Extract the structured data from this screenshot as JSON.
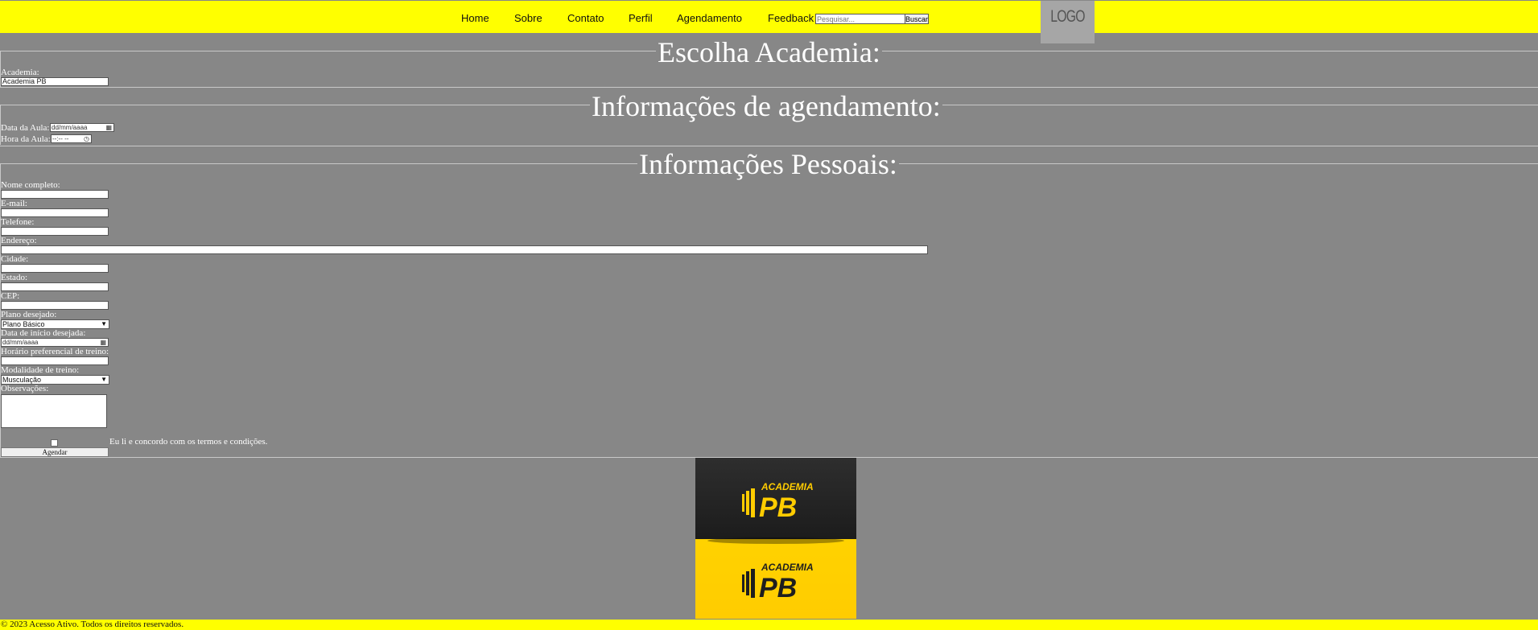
{
  "nav": {
    "items": [
      {
        "label": "Home"
      },
      {
        "label": "Sobre"
      },
      {
        "label": "Contato"
      },
      {
        "label": "Perfil"
      },
      {
        "label": "Agendamento"
      },
      {
        "label": "Feedback"
      }
    ],
    "search_placeholder": "Pesquisar...",
    "search_button": "Buscar",
    "logo_text": "LOGO"
  },
  "section_academia": {
    "legend": "Escolha Academia:",
    "label": "Academia:",
    "value": "Academia PB"
  },
  "section_agendamento": {
    "legend": "Informações de agendamento:",
    "date_label": "Data da Aula:",
    "date_placeholder": "dd/mm/aaaa",
    "time_label": "Hora da Aula:",
    "time_placeholder": "--:-- --"
  },
  "section_pessoais": {
    "legend": "Informações Pessoais:",
    "nome_label": "Nome completo:",
    "email_label": "E-mail:",
    "telefone_label": "Telefone:",
    "endereco_label": "Endereço:",
    "cidade_label": "Cidade:",
    "estado_label": "Estado:",
    "cep_label": "CEP:",
    "plano_label": "Plano desejado:",
    "plano_value": "Plano Básico",
    "data_inicio_label": "Data de início desejada:",
    "data_inicio_placeholder": "dd/mm/aaaa",
    "horario_label": "Horário preferencial de treino:",
    "modalidade_label": "Modalidade de treino:",
    "modalidade_value": "Musculação",
    "observacoes_label": "Observações:",
    "terms_label": "Eu li e concordo com os termos e condições.",
    "submit_label": "Agendar"
  },
  "brand_image": {
    "text_top": "ACADEMIA",
    "text_main": "PB",
    "colors": {
      "dark": "#262626",
      "yellow": "#ffcc00"
    }
  },
  "footer": {
    "text": "© 2023 Acesso Ativo. Todos os direitos reservados."
  }
}
